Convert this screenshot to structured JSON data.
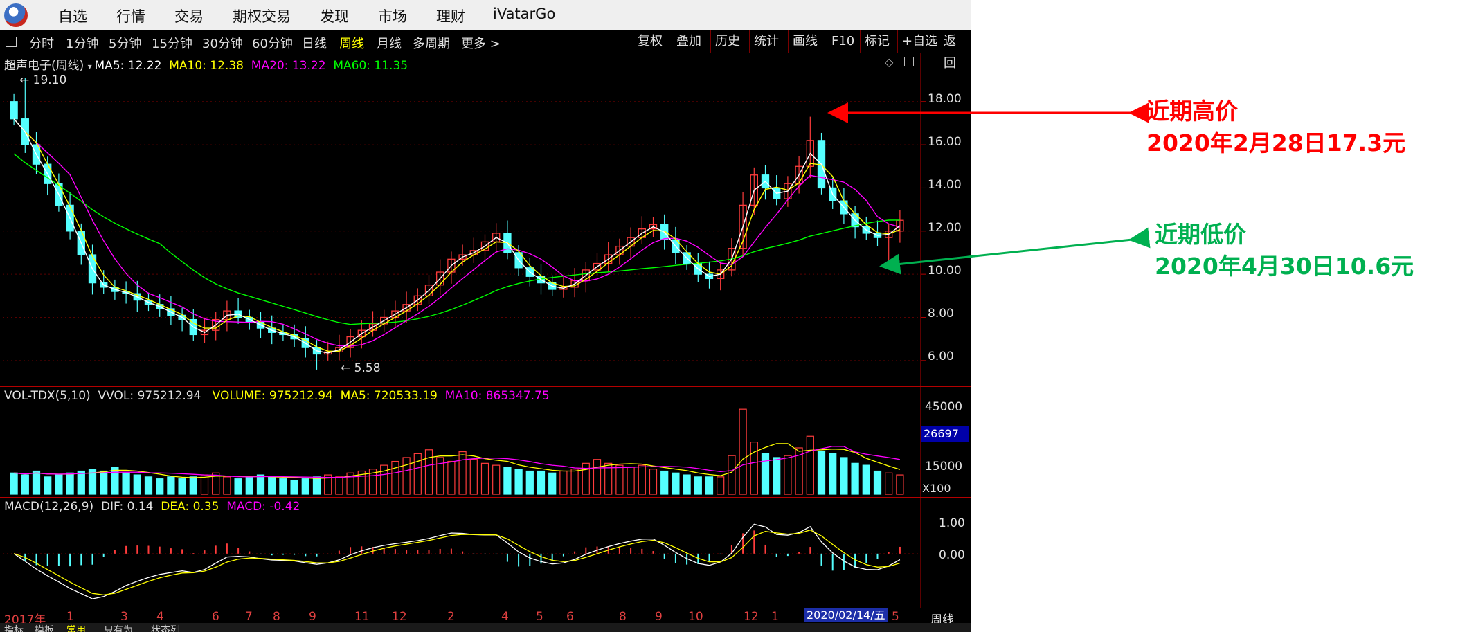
{
  "menubar": {
    "items": [
      "自选",
      "行情",
      "交易",
      "期权交易",
      "发现",
      "市场",
      "理财",
      "iVatarGo"
    ]
  },
  "toolbar": {
    "periods": [
      "分时",
      "1分钟",
      "5分钟",
      "15分钟",
      "30分钟",
      "60分钟",
      "日线",
      "周线",
      "月线",
      "多周期"
    ],
    "active_period": "周线",
    "more": "更多 >",
    "right_buttons": [
      "复权",
      "叠加",
      "历史",
      "统计",
      "画线",
      "F10",
      "标记",
      "+自选",
      "返回"
    ]
  },
  "price_panel": {
    "title": "超声电子(周线)",
    "ma": [
      {
        "label": "MA5: 12.22",
        "color": "#ffffff"
      },
      {
        "label": "MA10: 12.38",
        "color": "#ffff00"
      },
      {
        "label": "MA20: 13.22",
        "color": "#ff00ff"
      },
      {
        "label": "MA60: 11.35",
        "color": "#00ff00"
      }
    ],
    "y_ticks": [
      "18.00",
      "16.00",
      "14.00",
      "12.00",
      "10.00",
      "8.00",
      "6.00"
    ],
    "high_label": "19.10",
    "low_label": "5.58"
  },
  "volume_panel": {
    "title": "VOL-TDX(5,10)",
    "vvol": "VVOL: 975212.94",
    "volume": "VOLUME: 975212.94",
    "ma5": "MA5: 720533.19",
    "ma10": "MA10: 865347.75",
    "y_ticks": [
      "45000",
      "15000"
    ],
    "current_badge": "26697",
    "unit": "X100"
  },
  "macd_panel": {
    "title": "MACD(12,26,9)",
    "dif": "DIF: 0.14",
    "dea": "DEA: 0.35",
    "macd": "MACD: -0.42",
    "y_ticks": [
      "1.00",
      "0.00"
    ]
  },
  "time_axis": {
    "labels": [
      "2017年",
      "1",
      "3",
      "4",
      "6",
      "7",
      "8",
      "9",
      "11",
      "12",
      "2",
      "4",
      "5",
      "6",
      "8",
      "9",
      "10",
      "12",
      "1"
    ],
    "cursor_date": "2020/02/14/五",
    "tail_label": "5",
    "period_label": "周线"
  },
  "bottom_tabs": [
    "指标",
    "模板",
    "常用",
    "只有为",
    "状态列"
  ],
  "annotations": {
    "high": {
      "line1": "近期高价",
      "line2": "2020年2月28日17.3元",
      "color": "#ff0000"
    },
    "low": {
      "line1": "近期低价",
      "line2": "2020年4月30日10.6元",
      "color": "#00b050"
    }
  },
  "colors": {
    "up": "#ff3c3c",
    "down": "#54ffff",
    "ma5": "#ffffff",
    "ma10": "#ffff00",
    "ma20": "#ff00ff",
    "ma60": "#00ff00"
  },
  "chart_data": {
    "type": "candlestick",
    "title": "超声电子(周线)",
    "y_range": [
      5,
      19.5
    ],
    "price_key_points": {
      "high_2017": 19.1,
      "low_2018": 5.58,
      "high_2020_02_28": 17.3,
      "low_2020_04_30": 10.6
    },
    "close_series": [
      17.2,
      16.0,
      15.1,
      14.2,
      13.2,
      12.0,
      10.9,
      9.6,
      9.4,
      9.2,
      9.1,
      8.8,
      8.6,
      8.4,
      8.1,
      7.9,
      7.2,
      7.4,
      7.9,
      8.3,
      8.0,
      7.8,
      7.5,
      7.3,
      7.2,
      7.0,
      6.6,
      6.3,
      6.4,
      6.6,
      7.1,
      7.4,
      7.7,
      8.0,
      8.3,
      8.6,
      9.0,
      9.5,
      10.1,
      10.7,
      10.9,
      11.1,
      11.5,
      11.9,
      11.0,
      10.3,
      9.9,
      9.6,
      9.3,
      9.4,
      9.7,
      10.2,
      10.5,
      10.9,
      11.3,
      11.7,
      12.1,
      12.3,
      11.6,
      11.0,
      10.5,
      10.0,
      9.8,
      10.2,
      11.2,
      13.2,
      14.6,
      14.0,
      13.5,
      14.2,
      15.0,
      16.2,
      14.0,
      13.4,
      12.8,
      12.2,
      11.9,
      11.7,
      12.0,
      12.5
    ],
    "ma_lines": [
      "MA5",
      "MA10",
      "MA20",
      "MA60"
    ],
    "volume": {
      "values": [
        11,
        10,
        12,
        9,
        10,
        11,
        12,
        13,
        12,
        14,
        11,
        10,
        9,
        8,
        9,
        8,
        9,
        10,
        11,
        9,
        8,
        9,
        10,
        9,
        8,
        7,
        8,
        9,
        10,
        9,
        11,
        12,
        13,
        15,
        17,
        19,
        21,
        23,
        19,
        17,
        22,
        18,
        16,
        15,
        14,
        13,
        12,
        12,
        11,
        12,
        13,
        16,
        18,
        16,
        15,
        14,
        15,
        13,
        12,
        11,
        10,
        9,
        9,
        9,
        20,
        44,
        27,
        21,
        19,
        20,
        24,
        30,
        22,
        21,
        19,
        16,
        15,
        12,
        11,
        10
      ],
      "y_ticks": [
        15000,
        45000
      ]
    },
    "macd": {
      "y_range": [
        -1.8,
        1.5
      ],
      "dif_last": 0.14,
      "dea_last": 0.35,
      "macd_last": -0.42
    }
  }
}
